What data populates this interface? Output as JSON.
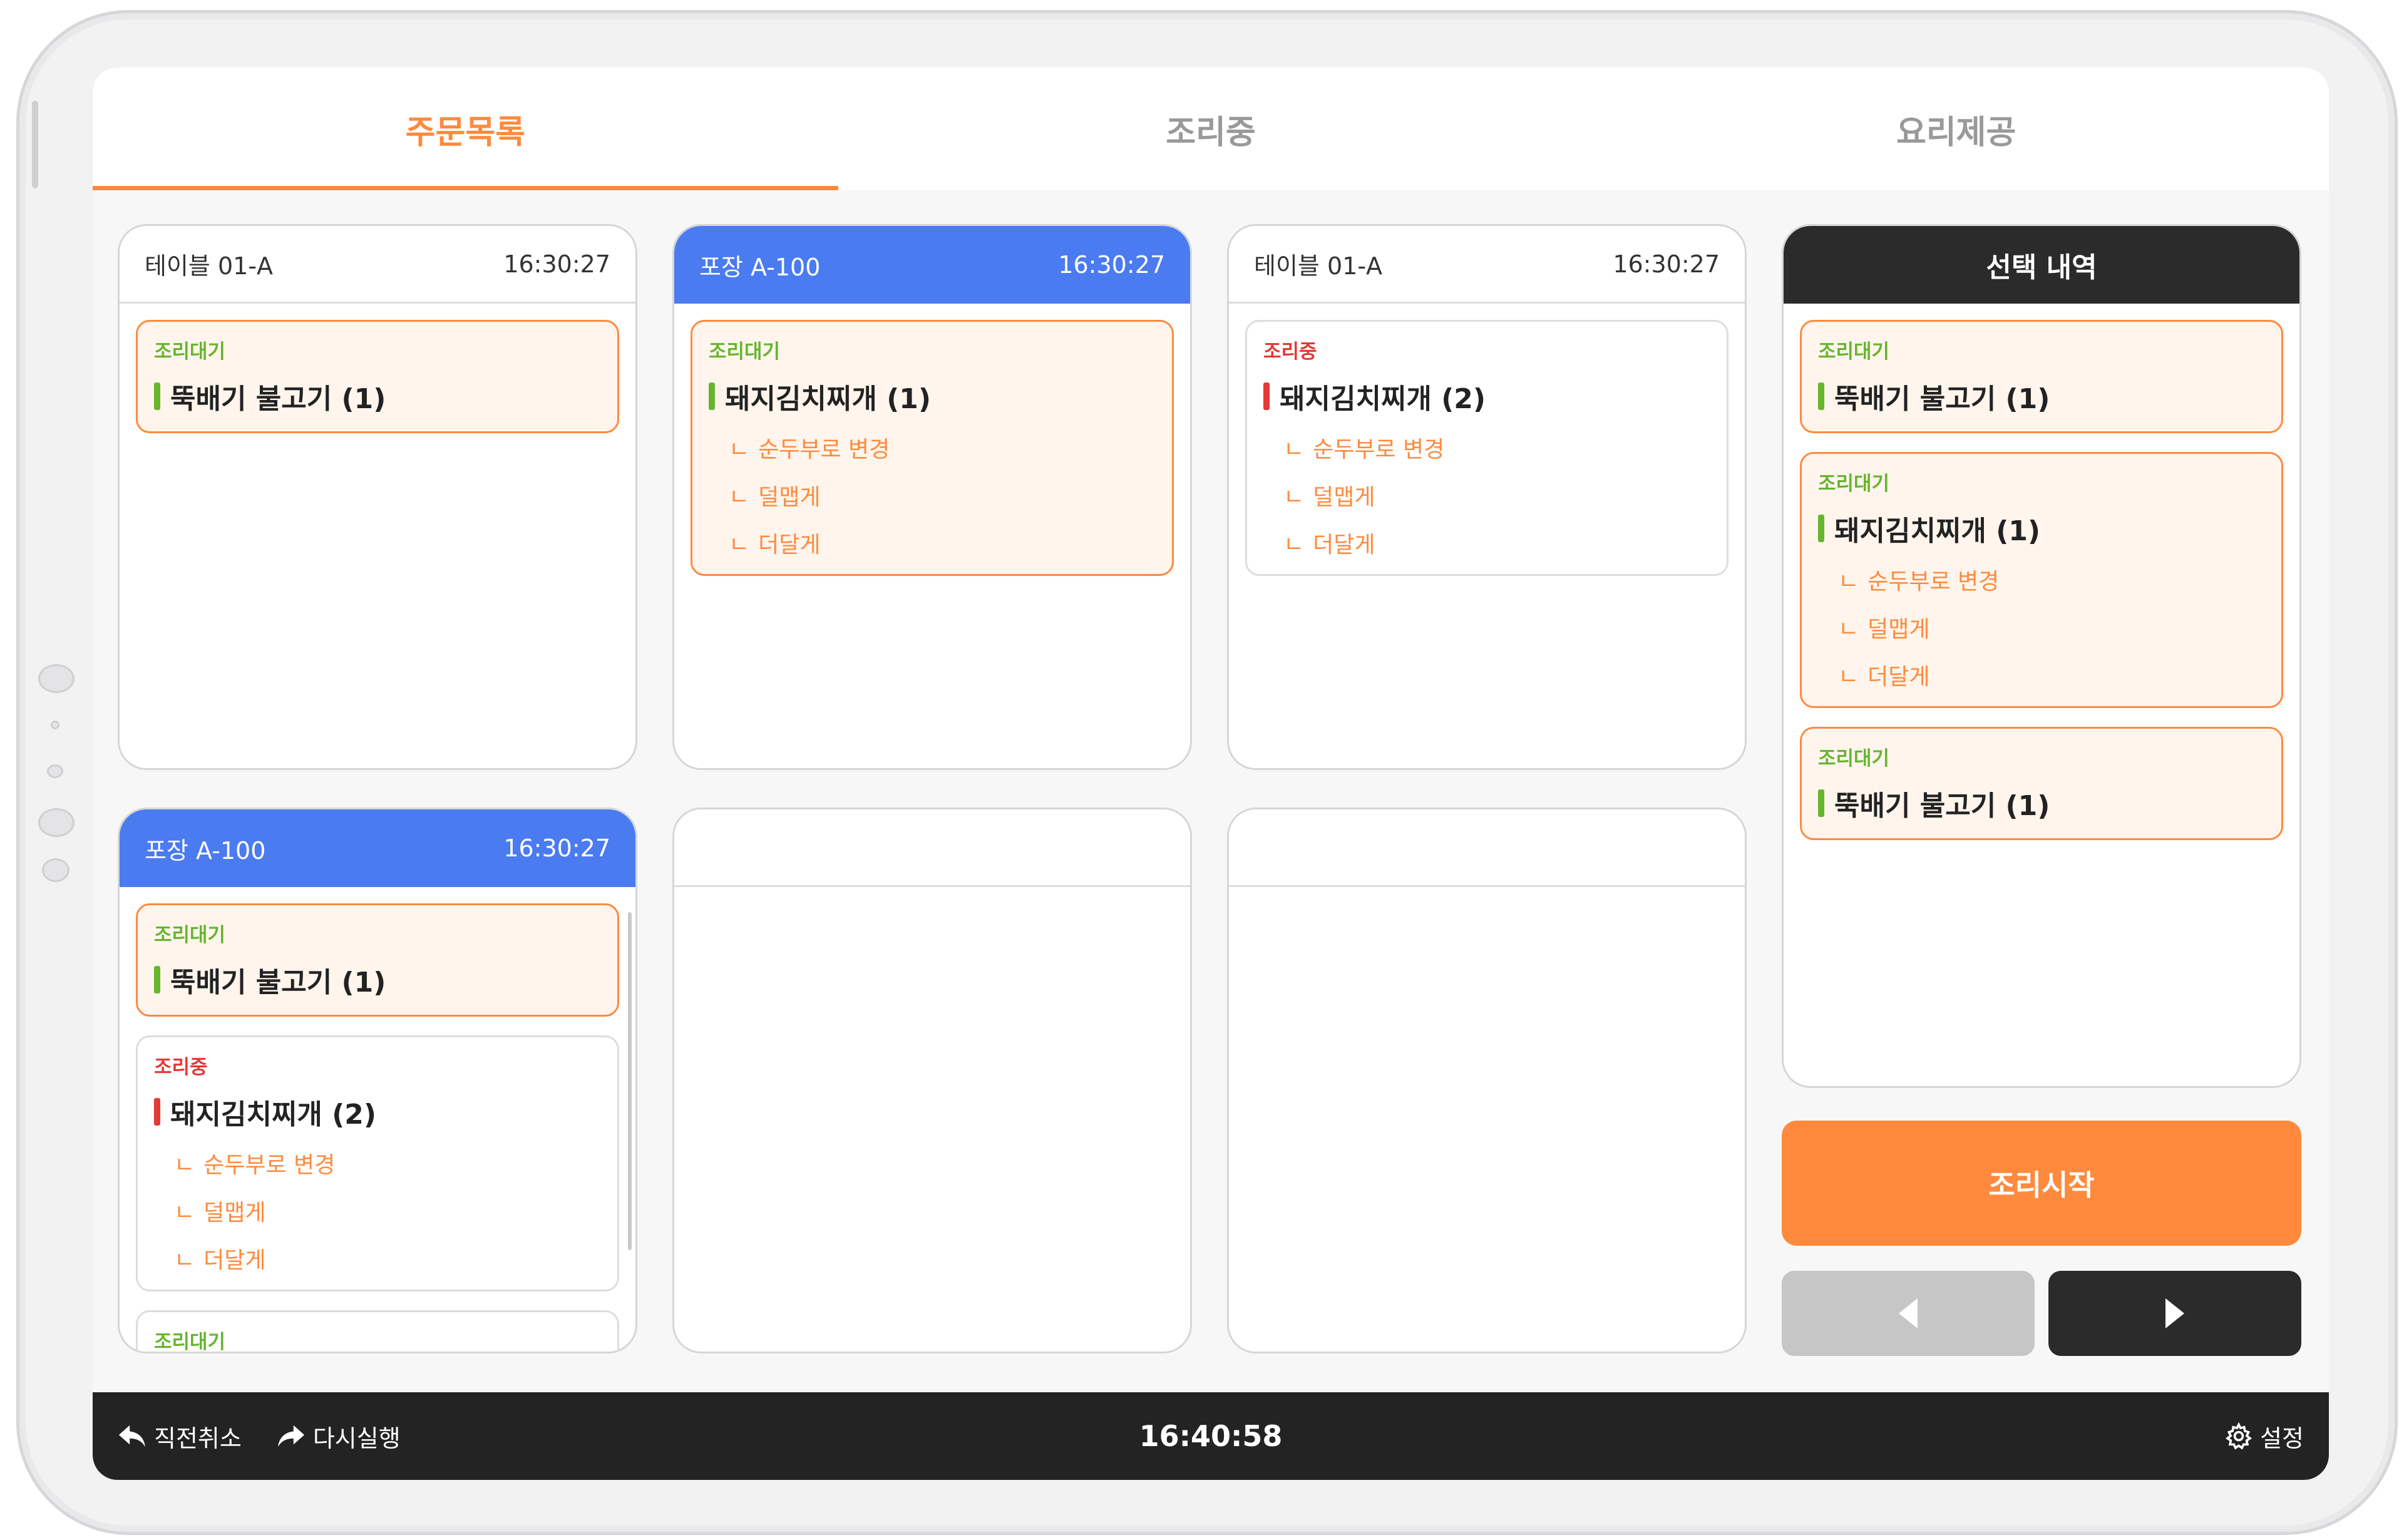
{
  "tabs": [
    {
      "label": "주문목록",
      "active": true
    },
    {
      "label": "조리중",
      "active": false
    },
    {
      "label": "요리제공",
      "active": false
    }
  ],
  "orders": [
    {
      "name": "테이블 01-A",
      "time": "16:30:27",
      "header_style": "white",
      "items": [
        {
          "status": "조리대기",
          "dish": "뚝배기 불고기 (1)",
          "options": []
        }
      ]
    },
    {
      "name": "포장 A-100",
      "time": "16:30:27",
      "header_style": "blue",
      "items": [
        {
          "status": "조리대기",
          "dish": "돼지김치찌개 (1)",
          "options": [
            "순두부로 변경",
            "덜맵게",
            "더달게"
          ]
        }
      ]
    },
    {
      "name": "테이블 01-A",
      "time": "16:30:27",
      "header_style": "white",
      "items": [
        {
          "status": "조리중",
          "dish": "돼지김치찌개 (2)",
          "options": [
            "순두부로 변경",
            "덜맵게",
            "더달게"
          ]
        }
      ]
    },
    {
      "name": "포장 A-100",
      "time": "16:30:27",
      "header_style": "blue",
      "items": [
        {
          "status": "조리대기",
          "dish": "뚝배기 불고기 (1)",
          "options": []
        },
        {
          "status": "조리중",
          "dish": "돼지김치찌개 (2)",
          "options": [
            "순두부로 변경",
            "덜맵게",
            "더달게"
          ]
        },
        {
          "status": "조리대기",
          "dish": "",
          "options": []
        }
      ]
    }
  ],
  "option_prefix": "ㄴ",
  "selection": {
    "title": "선택 내역",
    "items": [
      {
        "status": "조리대기",
        "dish": "뚝배기 불고기 (1)",
        "options": []
      },
      {
        "status": "조리대기",
        "dish": "돼지김치찌개 (1)",
        "options": [
          "순두부로 변경",
          "덜맵게",
          "더달게"
        ]
      },
      {
        "status": "조리대기",
        "dish": "뚝배기 불고기 (1)",
        "options": []
      }
    ]
  },
  "start_button": "조리시작",
  "pager": {
    "prev_icon": "triangle-left-icon",
    "next_icon": "triangle-right-icon"
  },
  "bottom_bar": {
    "undo": "직전취소",
    "redo": "다시실행",
    "clock": "16:40:58",
    "settings": "설정"
  },
  "colors": {
    "accent": "#ff8a3d",
    "waiting": "#66b52f",
    "cooking": "#e53935",
    "takeout_header": "#4b7bf0",
    "dark": "#2b2b2b"
  }
}
